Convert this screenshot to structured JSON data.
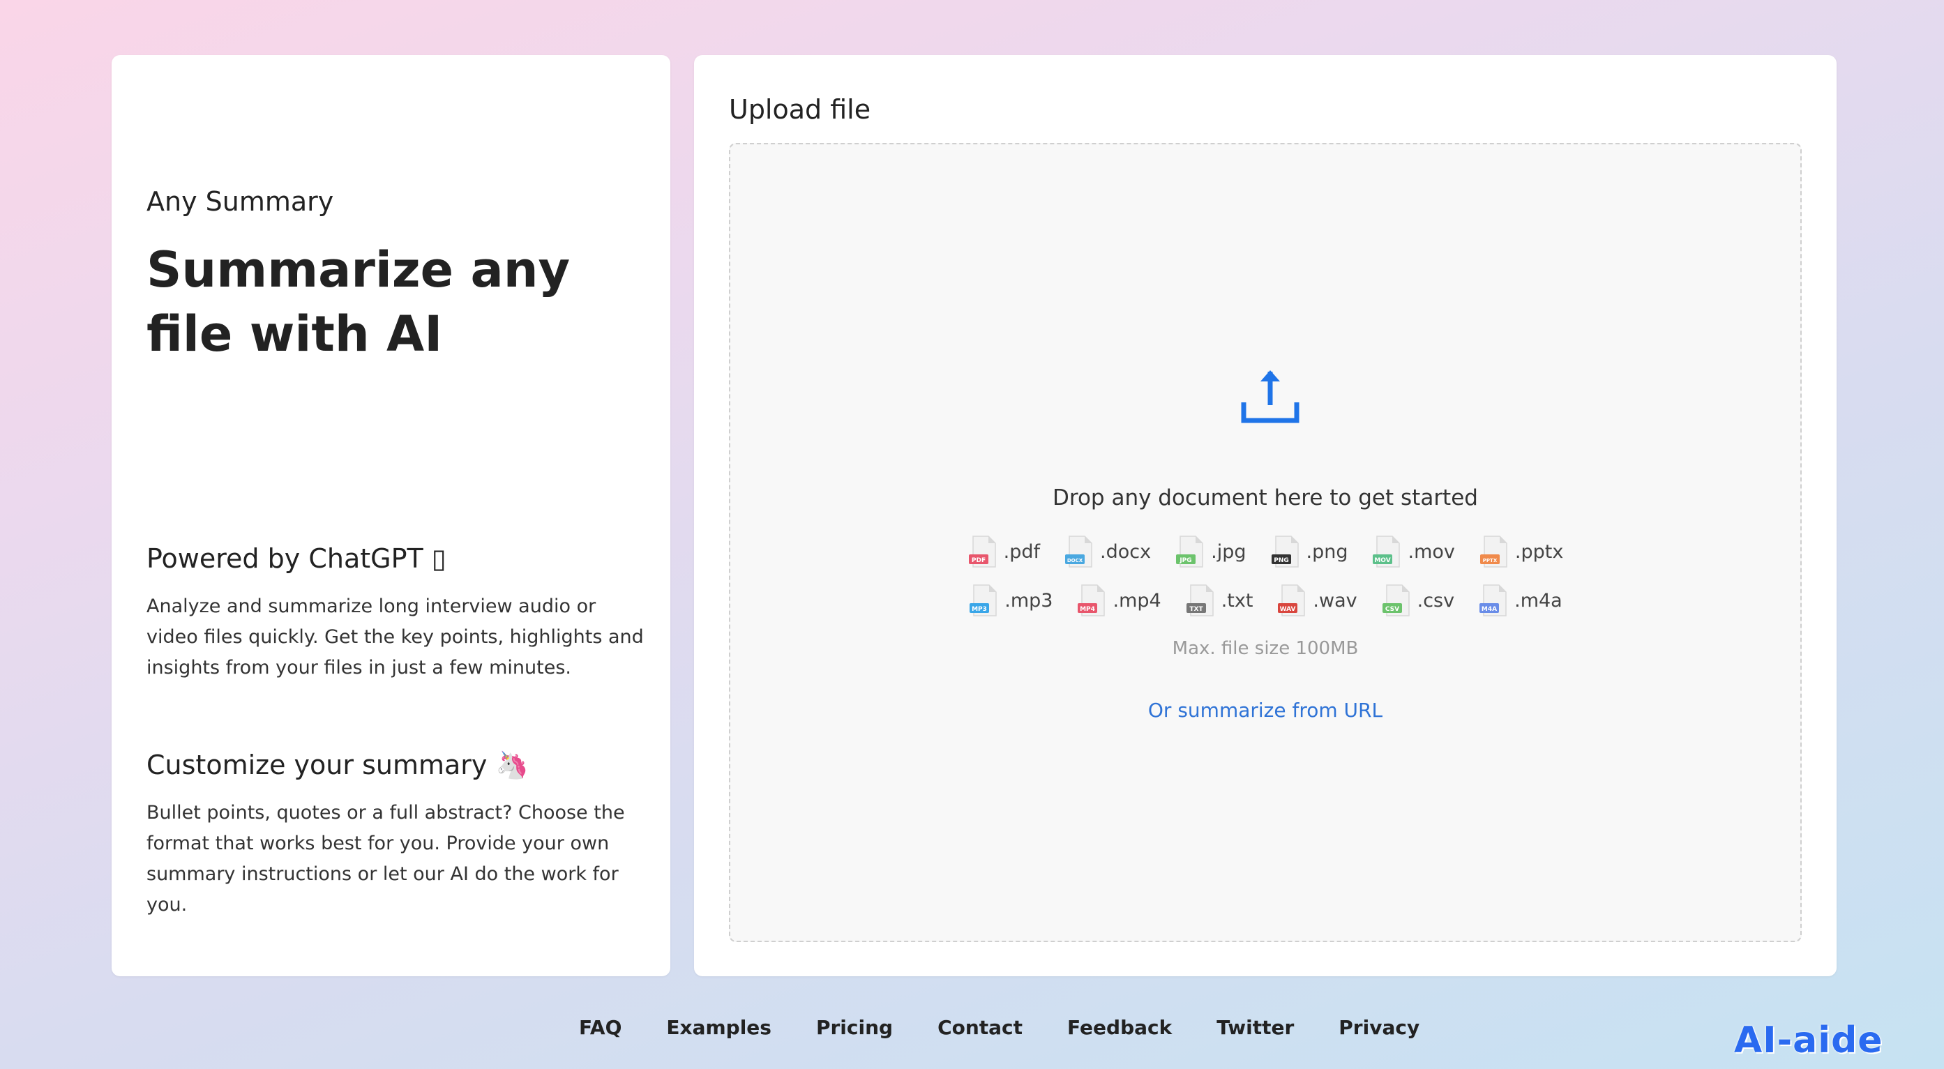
{
  "intro": {
    "app_name": "Any Summary",
    "title": "Summarize any file with AI"
  },
  "features": [
    {
      "heading": "Powered by ChatGPT ▯",
      "text": "Analyze and summarize long interview audio or video files quickly. Get the key points, highlights and insights from your files in just a few minutes."
    },
    {
      "heading": "Customize your summary 🦄",
      "text": "Bullet points, quotes or a full abstract? Choose the format that works best for you. Provide your own summary instructions or let our AI do the work for you."
    }
  ],
  "upload": {
    "title": "Upload file",
    "drop_text": "Drop any document here to get started",
    "max_size": "Max. file size 100MB",
    "url_link": "Or summarize from URL",
    "upload_icon": "upload-icon",
    "accent_color": "#2f73d6",
    "file_types": [
      {
        "label": ".pdf",
        "badge": "PDF",
        "color": "#e8566c"
      },
      {
        "label": ".docx",
        "badge": "DOCX",
        "color": "#4aa8e0"
      },
      {
        "label": ".jpg",
        "badge": "JPG",
        "color": "#6cc36c"
      },
      {
        "label": ".png",
        "badge": "PNG",
        "color": "#333333"
      },
      {
        "label": ".mov",
        "badge": "MOV",
        "color": "#5cc08a"
      },
      {
        "label": ".pptx",
        "badge": "PPTX",
        "color": "#f08a4b"
      },
      {
        "label": ".mp3",
        "badge": "MP3",
        "color": "#3aa6e8"
      },
      {
        "label": ".mp4",
        "badge": "MP4",
        "color": "#e8566c"
      },
      {
        "label": ".txt",
        "badge": "TXT",
        "color": "#777777"
      },
      {
        "label": ".wav",
        "badge": "WAV",
        "color": "#d9463e"
      },
      {
        "label": ".csv",
        "badge": "CSV",
        "color": "#6cc36c"
      },
      {
        "label": ".m4a",
        "badge": "M4A",
        "color": "#6a8de8"
      }
    ]
  },
  "footer": {
    "links": [
      "FAQ",
      "Examples",
      "Pricing",
      "Contact",
      "Feedback",
      "Twitter",
      "Privacy"
    ]
  },
  "brand": "AI-aide"
}
